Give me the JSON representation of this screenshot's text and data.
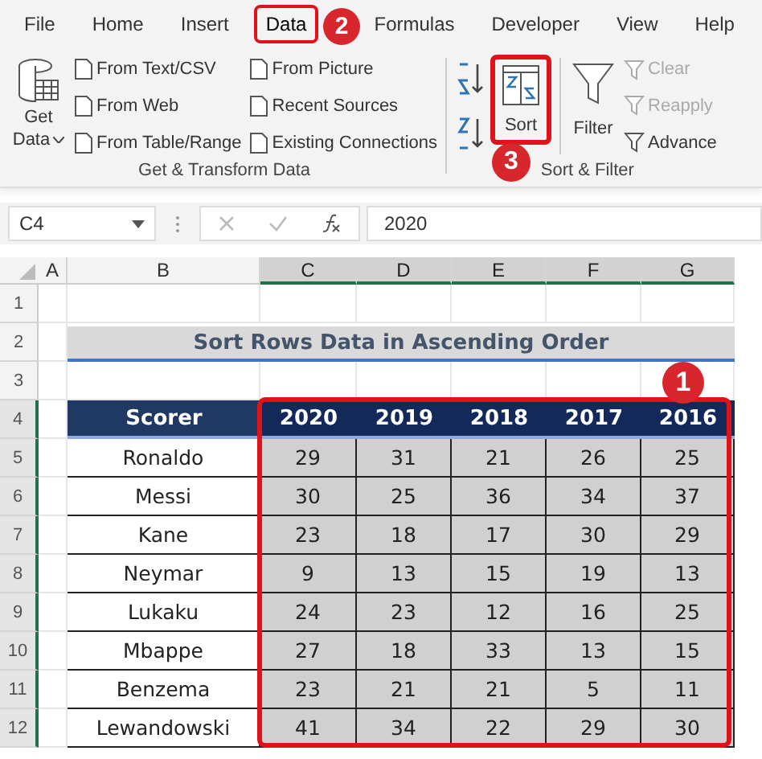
{
  "tabs": [
    {
      "label": "File",
      "selected": false,
      "highlighted": false
    },
    {
      "label": "Home",
      "selected": false,
      "highlighted": false
    },
    {
      "label": "Insert",
      "selected": false,
      "highlighted": false
    },
    {
      "label": "Data",
      "selected": true,
      "highlighted": true
    },
    {
      "label": "Formulas",
      "selected": false,
      "highlighted": false
    },
    {
      "label": "Developer",
      "selected": false,
      "highlighted": false
    },
    {
      "label": "View",
      "selected": false,
      "highlighted": false
    },
    {
      "label": "Help",
      "selected": false,
      "highlighted": false
    }
  ],
  "get_transform": {
    "get_data": "Get",
    "get_data_line2": "Data",
    "column_1": [
      "From Text/CSV",
      "From Web",
      "From Table/Range"
    ],
    "column_2": [
      "From Picture",
      "Recent Sources",
      "Existing Connections"
    ],
    "label": "Get & Transform Data"
  },
  "sort_filter": {
    "sort": {
      "label": "Sort",
      "highlighted": true
    },
    "filter": "Filter",
    "options": [
      {
        "label": "Clear",
        "disabled": true
      },
      {
        "label": "Reapply",
        "disabled": true
      },
      {
        "label": "Advance",
        "disabled": false
      }
    ],
    "label": "Sort & Filter"
  },
  "callouts": [
    "1",
    "2",
    "3"
  ],
  "formula_bar": {
    "name_box": "C4",
    "value": "2020"
  },
  "columns": [
    {
      "label": "A",
      "selected": false
    },
    {
      "label": "B",
      "selected": false
    },
    {
      "label": "C",
      "selected": true
    },
    {
      "label": "D",
      "selected": true
    },
    {
      "label": "E",
      "selected": true
    },
    {
      "label": "F",
      "selected": true
    },
    {
      "label": "G",
      "selected": true
    }
  ],
  "row_numbers": [
    {
      "label": "1",
      "selected": false
    },
    {
      "label": "2",
      "selected": false
    },
    {
      "label": "3",
      "selected": false
    },
    {
      "label": "4",
      "selected": true
    },
    {
      "label": "5",
      "selected": true
    },
    {
      "label": "6",
      "selected": true
    },
    {
      "label": "7",
      "selected": true
    },
    {
      "label": "8",
      "selected": true
    },
    {
      "label": "9",
      "selected": true
    },
    {
      "label": "10",
      "selected": true
    },
    {
      "label": "11",
      "selected": true
    },
    {
      "label": "12",
      "selected": true
    }
  ],
  "sheet_title": "Sort Rows Data in Ascending Order",
  "table": {
    "header": [
      "Scorer",
      "2020",
      "2019",
      "2018",
      "2017",
      "2016"
    ],
    "values_selected": true,
    "highlighted": true,
    "rows": [
      {
        "name": "Ronaldo",
        "values": [
          "29",
          "31",
          "21",
          "26",
          "25"
        ]
      },
      {
        "name": "Messi",
        "values": [
          "30",
          "25",
          "36",
          "34",
          "37"
        ]
      },
      {
        "name": "Kane",
        "values": [
          "23",
          "18",
          "17",
          "30",
          "29"
        ]
      },
      {
        "name": "Neymar",
        "values": [
          "9",
          "13",
          "15",
          "19",
          "13"
        ]
      },
      {
        "name": "Lukaku",
        "values": [
          "24",
          "23",
          "12",
          "16",
          "25"
        ]
      },
      {
        "name": "Mbappe",
        "values": [
          "27",
          "18",
          "33",
          "13",
          "15"
        ]
      },
      {
        "name": "Benzema",
        "values": [
          "23",
          "21",
          "21",
          "5",
          "11"
        ]
      },
      {
        "name": "Lewandowski",
        "values": [
          "41",
          "34",
          "22",
          "29",
          "30"
        ]
      }
    ]
  }
}
